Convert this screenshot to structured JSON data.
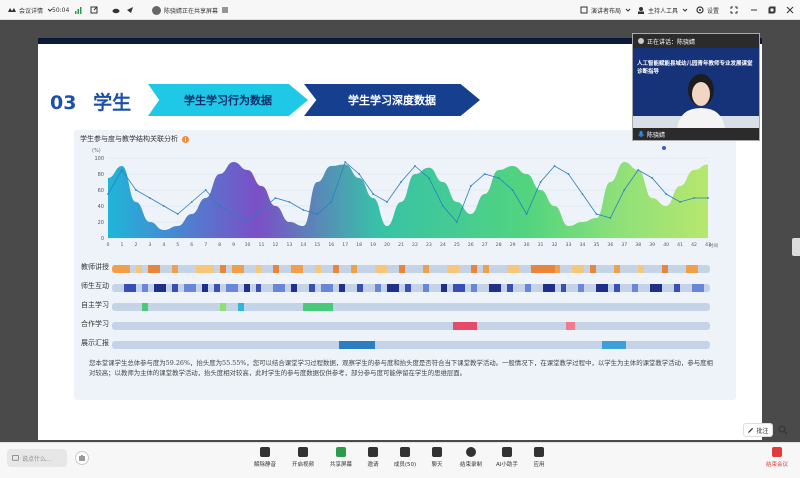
{
  "topbar": {
    "meeting_details": "会议详情",
    "timer": "50:04",
    "sharing_text": "陈骁婧正在共享屏幕",
    "presenter_layout": "演讲者布局",
    "host_tools": "主持人工具",
    "settings": "设置"
  },
  "slide": {
    "section_number": "03",
    "section_title": "学生",
    "tab1": "学生学习行为数据",
    "tab2": "学生学习深度数据"
  },
  "panel": {
    "title": "学生参与度与教学结构关联分析",
    "ylabel": "(%)",
    "xlabel": "时间"
  },
  "chart_data": {
    "type": "area",
    "title": "学生参与度与教学结构关联分析",
    "ylabel": "(%)",
    "xlabel": "时间",
    "ylim": [
      0,
      100
    ],
    "yticks": [
      0,
      20,
      40,
      60,
      80,
      100
    ],
    "x": [
      0,
      1,
      2,
      3,
      4,
      5,
      6,
      7,
      8,
      9,
      10,
      11,
      12,
      13,
      14,
      15,
      16,
      17,
      18,
      19,
      20,
      21,
      22,
      23,
      24,
      25,
      26,
      27,
      28,
      29,
      30,
      31,
      32,
      33,
      34,
      35,
      36,
      37,
      38,
      39,
      40,
      41,
      42,
      43
    ],
    "series": [
      {
        "values": [
          75,
          90,
          45,
          20,
          10,
          15,
          30,
          50,
          80,
          95,
          85,
          65,
          40,
          20,
          15,
          70,
          90,
          92,
          75,
          50,
          15,
          45,
          80,
          88,
          70,
          45,
          30,
          55,
          85,
          90,
          80,
          60,
          40,
          15,
          20,
          25,
          70,
          95,
          85,
          50,
          40,
          65,
          85,
          92
        ]
      },
      {
        "values": [
          55,
          85,
          60,
          50,
          40,
          30,
          45,
          60,
          40,
          30,
          20,
          35,
          50,
          45,
          35,
          30,
          45,
          95,
          80,
          55,
          45,
          70,
          90,
          75,
          40,
          20,
          65,
          80,
          75,
          60,
          30,
          70,
          90,
          80,
          55,
          30,
          25,
          60,
          85,
          75,
          55,
          45,
          50,
          50
        ]
      }
    ]
  },
  "rows": [
    "教师讲授",
    "师生互动",
    "自主学习",
    "合作学习",
    "展示汇报"
  ],
  "summary": "您本堂课学生总体参与度为59.26%，抬头度为55.55%，您可以结合课堂学习过程数据，观察学生的参与度和抬头度是否符合当下课堂教学活动。一般情况下，在课堂教学过程中，以学生为主体的课堂教学活动，参与度相对较高；以教师为主体的课堂教学活动，抬头度相对较高，此时学生的参与度数据仅供参考，部分参与度可能停留在学生的思维层面。",
  "camera": {
    "speaking_label": "正在讲话：陈骁婧",
    "banner": "人工智能赋能县域幼儿园青年教师专业发展课堂诊断指导",
    "speaker_name": "陈骁婧"
  },
  "annotate": "批注",
  "bottombar": {
    "chat_placeholder": "说点什么...",
    "tools": [
      "解除静音",
      "开启视频",
      "共享屏幕",
      "邀请",
      "成员(50)",
      "聊天",
      "结束录制",
      "AI小助手",
      "应用"
    ],
    "end": "结束会议"
  }
}
